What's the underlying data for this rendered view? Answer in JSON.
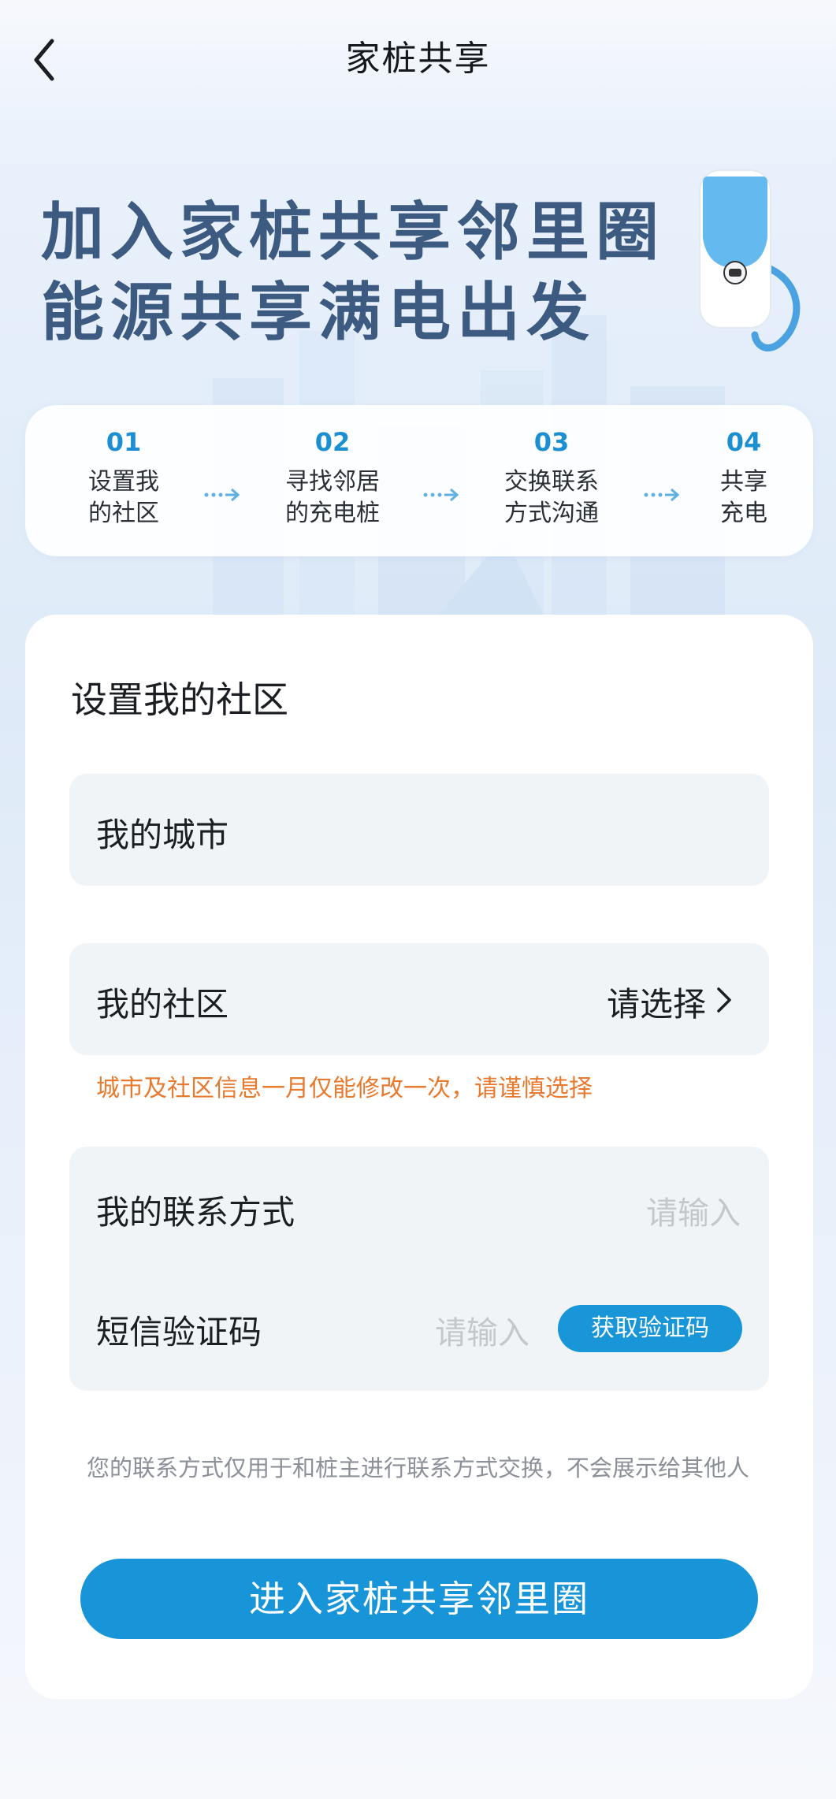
{
  "header": {
    "title": "家桩共享"
  },
  "hero": {
    "line1": "加入家桩共享邻里圈",
    "line2": "能源共享满电出发"
  },
  "steps": [
    {
      "num": "01",
      "line1": "设置我",
      "line2": "的社区"
    },
    {
      "num": "02",
      "line1": "寻找邻居",
      "line2": "的充电桩"
    },
    {
      "num": "03",
      "line1": "交换联系",
      "line2": "方式沟通"
    },
    {
      "num": "04",
      "line1": "共享",
      "line2": "充电"
    }
  ],
  "form": {
    "section_title": "设置我的社区",
    "city_label": "我的城市",
    "community_label": "我的社区",
    "community_value": "请选择",
    "warning": "城市及社区信息一月仅能修改一次，请谨慎选择",
    "contact_label": "我的联系方式",
    "contact_placeholder": "请输入",
    "sms_label": "短信验证码",
    "sms_placeholder": "请输入",
    "get_code_label": "获取验证码",
    "notice": "您的联系方式仅用于和桩主进行联系方式交换，不会展示给其他人",
    "submit_label": "进入家桩共享邻里圈"
  },
  "colors": {
    "accent": "#1894d8",
    "warning": "#e87a2f",
    "hero_text": "#3d5a80"
  }
}
